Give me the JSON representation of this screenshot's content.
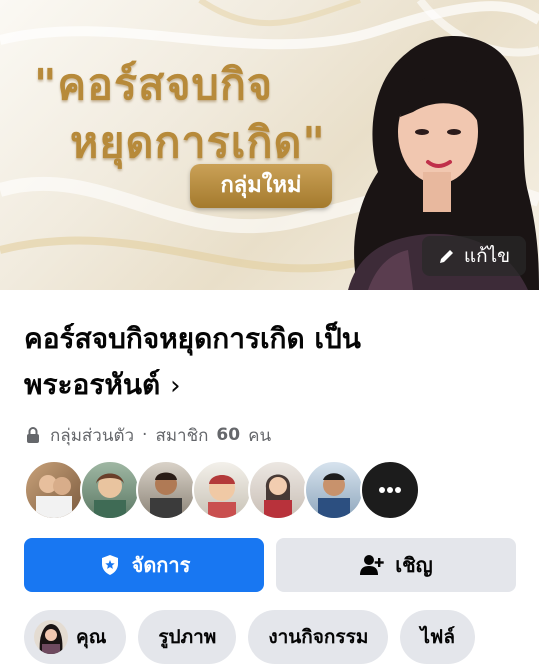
{
  "cover": {
    "headline_line1": "\"คอร์สจบกิจ",
    "headline_line2": "หยุดการเกิด\"",
    "tag": "กลุ่มใหม่",
    "edit_label": "แก้ไข"
  },
  "group": {
    "name": "คอร์สจบกิจหยุดการเกิด เป็นพระอรหันต์",
    "name_line1": "คอร์สจบกิจหยุดการเกิด เป็น",
    "name_line2": "พระอรหันต์",
    "chevron": "›",
    "privacy": "กลุ่มส่วนตัว",
    "separator": "·",
    "members_label": "สมาชิก",
    "members_count": "60",
    "members_unit": "คน"
  },
  "members": {
    "visible_avatars": 7,
    "more_glyph": "•••"
  },
  "actions": {
    "manage_label": "จัดการ",
    "invite_label": "เชิญ"
  },
  "tabs": [
    {
      "label": "คุณ"
    },
    {
      "label": "รูปภาพ"
    },
    {
      "label": "งานกิจกรรม"
    },
    {
      "label": "ไฟล์"
    }
  ],
  "colors": {
    "accent": "#1877f2",
    "secondary_button": "#e4e6eb",
    "gold": "#b78a3a",
    "muted_text": "#65676b"
  },
  "icons": {
    "edit": "pencil-icon",
    "privacy": "lock-icon",
    "manage": "shield-star-icon",
    "invite": "add-person-icon",
    "more": "more-dots-icon"
  }
}
